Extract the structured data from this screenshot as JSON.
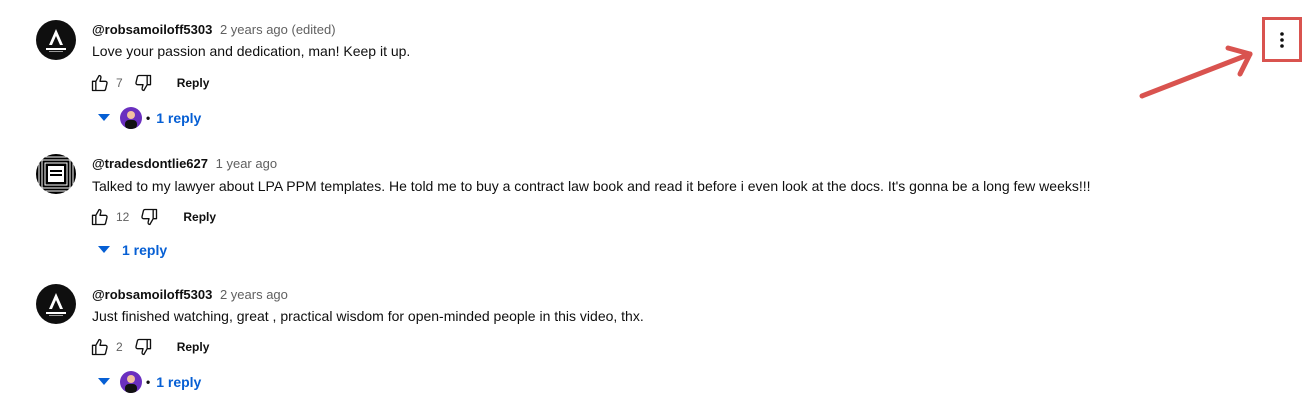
{
  "comments": [
    {
      "author": "@robsamoiloff5303",
      "time": "2 years ago (edited)",
      "text": "Love your passion and dedication, man! Keep it up.",
      "likes": "7",
      "reply_label": "Reply",
      "replies_label": "1 reply"
    },
    {
      "author": "@tradesdontlie627",
      "time": "1 year ago",
      "text": "Talked to my lawyer about LPA PPM templates. He told me to buy a contract law book and read it before i even look at the docs. It's gonna be a long few weeks!!!",
      "likes": "12",
      "reply_label": "Reply",
      "replies_label": "1 reply"
    },
    {
      "author": "@robsamoiloff5303",
      "time": "2 years ago",
      "text": "Just finished watching, great , practical wisdom for open-minded people in this video, thx.",
      "likes": "2",
      "reply_label": "Reply",
      "replies_label": "1 reply"
    }
  ],
  "colors": {
    "link": "#065fd4",
    "annotation": "#d9534f",
    "secondary_text": "#606060"
  },
  "icons": [
    "thumb-up-icon",
    "thumb-down-icon",
    "caret-down-icon",
    "more-vert-icon",
    "annotation-arrow"
  ]
}
